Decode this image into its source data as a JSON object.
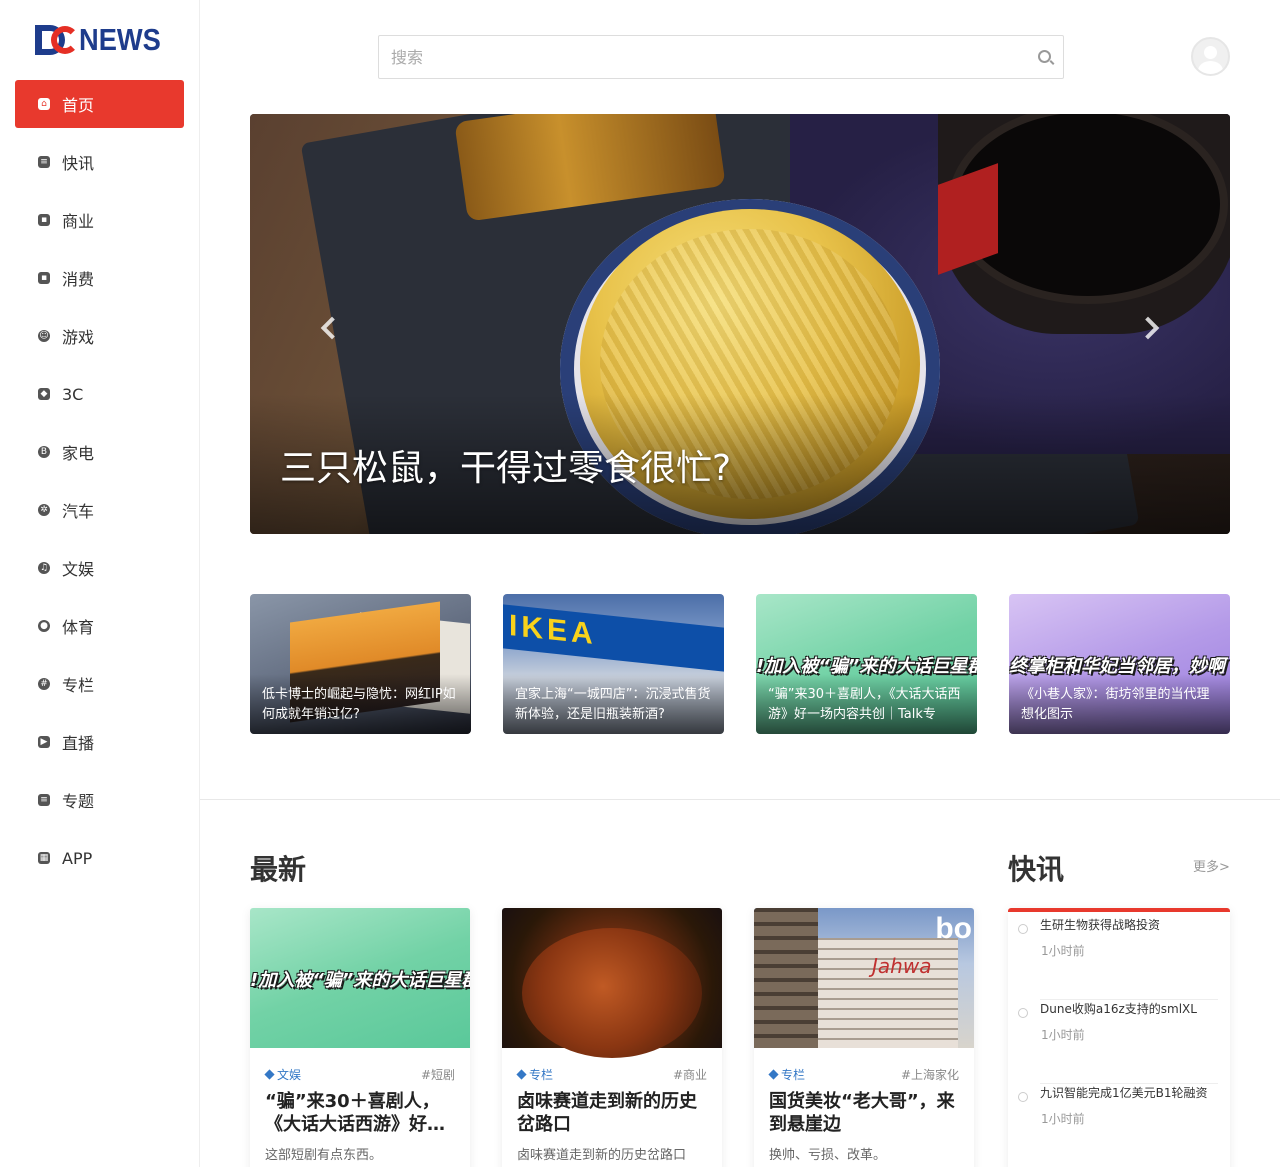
{
  "brand": {
    "logo_text": "NEWS",
    "logo_mark": "DO"
  },
  "sidebar": {
    "items": [
      {
        "label": "首页",
        "icon": "home-icon",
        "glyph": "⌂",
        "active": true
      },
      {
        "label": "快讯",
        "icon": "flash-icon",
        "glyph": "≡"
      },
      {
        "label": "商业",
        "icon": "briefcase-icon",
        "glyph": "▪"
      },
      {
        "label": "消费",
        "icon": "wallet-icon",
        "glyph": "▪"
      },
      {
        "label": "游戏",
        "icon": "gamepad-icon",
        "glyph": "☺"
      },
      {
        "label": "3C",
        "icon": "cube-icon",
        "glyph": "◆"
      },
      {
        "label": "家电",
        "icon": "appliance-icon",
        "glyph": "B"
      },
      {
        "label": "汽车",
        "icon": "wheel-icon",
        "glyph": "✲"
      },
      {
        "label": "文娱",
        "icon": "music-icon",
        "glyph": "♫"
      },
      {
        "label": "体育",
        "icon": "ball-icon",
        "glyph": "●"
      },
      {
        "label": "专栏",
        "icon": "column-icon",
        "glyph": "#"
      },
      {
        "label": "直播",
        "icon": "live-icon",
        "glyph": "▶"
      },
      {
        "label": "专题",
        "icon": "topic-icon",
        "glyph": "≡"
      },
      {
        "label": "APP",
        "icon": "grid-icon",
        "glyph": "▦"
      }
    ]
  },
  "header": {
    "search_placeholder": "搜索"
  },
  "hero": {
    "title": "三只松鼠，干得过零食很忙?"
  },
  "thumbs": [
    {
      "caption": "低卡博士的崛起与隐忧：网红IP如何成就年销过亿?",
      "banner": ""
    },
    {
      "caption": "宜家上海“一城四店”：沉浸式售货新体验，还是旧瓶装新酒?",
      "banner": "",
      "sign_text": "IKEA"
    },
    {
      "caption": "“骗”来30＋喜剧人，《大话大话西游》好一场内容共创｜Talk专",
      "banner": "!加入被“骗”来的大话巨星群"
    },
    {
      "caption": "《小巷人家》：街坊邻里的当代理想化图示",
      "banner": "终掌柜和华妃当邻居，妙啊"
    }
  ],
  "latest": {
    "title": "最新",
    "cards": [
      {
        "category": "文娱",
        "tag": "#短剧",
        "title": "“骗”来30＋喜剧人，《大话大话西游》好…",
        "desc": "这部短剧有点东西。",
        "banner": "!加入被“骗”来的大话巨星群"
      },
      {
        "category": "专栏",
        "tag": "#商业",
        "title": "卤味赛道走到新的历史岔路口",
        "desc": "卤味赛道走到新的历史岔路口"
      },
      {
        "category": "专栏",
        "tag": "#上海家化",
        "title": "国货美妆“老大哥”，来到悬崖边",
        "desc": "换帅、亏损、改革。",
        "logo_text": "bo",
        "sign_text": "Jahwa"
      }
    ]
  },
  "flash": {
    "title": "快讯",
    "more_label": "更多>",
    "items": [
      {
        "text": "生研生物获得战略投资",
        "time": "1小时前"
      },
      {
        "text": "Dune收购a16z支持的smlXL",
        "time": "1小时前"
      },
      {
        "text": "九识智能完成1亿美元B1轮融资",
        "time": "1小时前"
      }
    ]
  },
  "colors": {
    "accent": "#e8392d",
    "brand_blue": "#1e3c8c",
    "link_blue": "#3478c6"
  }
}
